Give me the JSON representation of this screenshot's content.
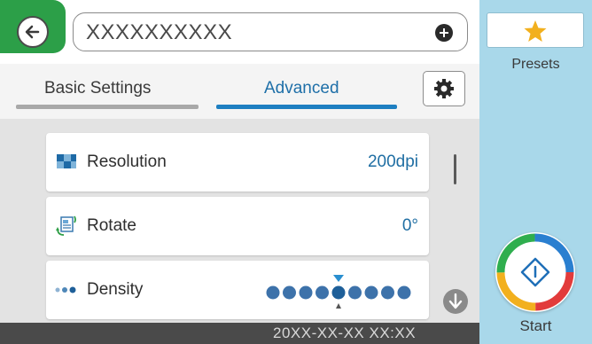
{
  "header": {
    "title_field_value": "XXXXXXXXXX",
    "back_icon": "back-arrow-icon",
    "add_icon": "plus-circle-icon"
  },
  "tabs": [
    {
      "label": "Basic Settings",
      "selected": false
    },
    {
      "label": "Advanced",
      "selected": true
    }
  ],
  "settings_icon": "gear-icon",
  "rows": [
    {
      "label": "Resolution",
      "value": "200dpi",
      "icon": "resolution-icon"
    },
    {
      "label": "Rotate",
      "value": "0°",
      "icon": "rotate-icon"
    },
    {
      "label": "Density",
      "value": "",
      "icon": "density-dots-icon",
      "level_index": 4,
      "level_count": 9
    }
  ],
  "status_bar": {
    "datetime": "20XX-XX-XX XX:XX"
  },
  "side_panel": {
    "presets_label": "Presets",
    "presets_icon": "star-icon",
    "start_label": "Start",
    "start_icon": "start-diamond-icon"
  },
  "colors": {
    "back_accent": "#2c9f48",
    "active_tab": "#1e7fc1",
    "side_panel": "#a9d8ea",
    "value_text": "#1f6ea3",
    "star": "#f2b01e"
  }
}
